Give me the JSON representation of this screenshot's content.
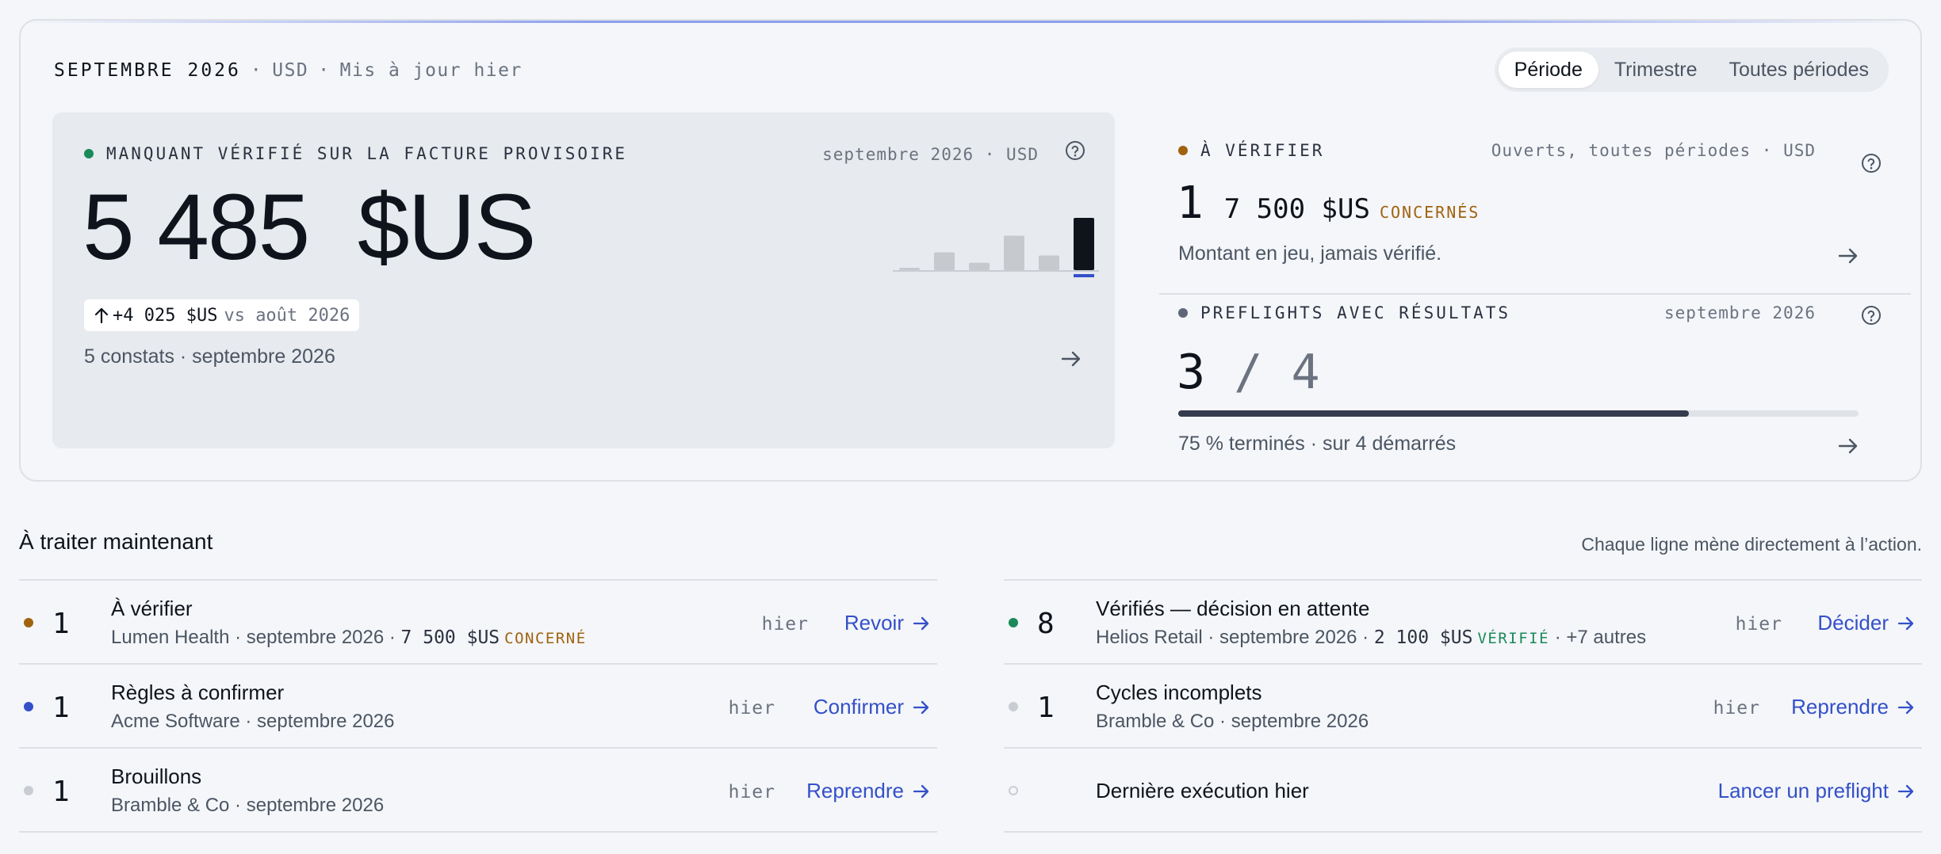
{
  "header": {
    "month": "SEPTEMBRE 2026",
    "currency": "USD",
    "updated": "Mis à jour hier",
    "separator": "·"
  },
  "period_tabs": [
    {
      "label": "Période",
      "active": true
    },
    {
      "label": "Trimestre",
      "active": false
    },
    {
      "label": "Toutes périodes",
      "active": false
    }
  ],
  "main_panel": {
    "kicker": "MANQUANT VÉRIFIÉ SUR LA FACTURE PROVISOIRE",
    "meta": "septembre 2026 · USD",
    "value": "5 485  $US",
    "delta_value": "+4 025  $US",
    "delta_vs": "vs août 2026",
    "footer": "5 constats · septembre 2026",
    "dot_color": "#1a8a5a",
    "sparkline_levels": [
      0.04,
      0.34,
      0.14,
      0.66,
      0.28,
      1.0
    ],
    "sparkline_highlight_index": 5
  },
  "verify_block": {
    "kicker": "À VÉRIFIER",
    "meta": "Ouverts, toutes périodes · USD",
    "count": "1",
    "amount": "7 500  $US",
    "tag": "CONCERNÉS",
    "text": "Montant en jeu, jamais vérifié.",
    "dot_color": "#a0620f"
  },
  "preflight_block": {
    "kicker": "PREFLIGHTS AVEC RÉSULTATS",
    "meta": "septembre 2026",
    "done": "3",
    "slash": " / ",
    "total": "4",
    "progress": 0.75,
    "text": "75 % terminés · sur 4 démarrés",
    "dot_color": "#5e6678"
  },
  "section": {
    "title": "À traiter maintenant",
    "note": "Chaque ligne mène directement à l’action."
  },
  "colors": {
    "accent_blue": "#3450c9",
    "amber": "#a0620f",
    "green": "#1a8a5a",
    "grey_dot": "#c9ccd2"
  },
  "tasks_left": [
    {
      "dot": "#a0620f",
      "count": "1",
      "title": "À vérifier",
      "sub_prefix": "Lumen Health · septembre 2026 · ",
      "sub_amount": "7 500  $US",
      "sub_tag": "CONCERNÉ",
      "sub_tag_color": "#a0620f",
      "sub_suffix": "",
      "when": "hier",
      "action": "Revoir"
    },
    {
      "dot": "#3450c9",
      "count": "1",
      "title": "Règles à confirmer",
      "sub_prefix": "Acme Software · septembre 2026",
      "sub_amount": "",
      "sub_tag": "",
      "sub_tag_color": "",
      "sub_suffix": "",
      "when": "hier",
      "action": "Confirmer"
    },
    {
      "dot": "#c9ccd2",
      "count": "1",
      "title": "Brouillons",
      "sub_prefix": "Bramble & Co · septembre 2026",
      "sub_amount": "",
      "sub_tag": "",
      "sub_tag_color": "",
      "sub_suffix": "",
      "when": "hier",
      "action": "Reprendre"
    }
  ],
  "tasks_right": [
    {
      "dot": "#1a8a5a",
      "count": "8",
      "title": "Vérifiés — décision en attente",
      "sub_prefix": "Helios Retail · septembre 2026 · ",
      "sub_amount": "2 100  $US",
      "sub_tag": "VÉRIFIÉ",
      "sub_tag_color": "#1a8a5a",
      "sub_suffix": " · +7 autres",
      "when": "hier",
      "action": "Décider"
    },
    {
      "dot": "#c9ccd2",
      "count": "1",
      "title": "Cycles incomplets",
      "sub_prefix": "Bramble & Co · septembre 2026",
      "sub_amount": "",
      "sub_tag": "",
      "sub_tag_color": "",
      "sub_suffix": "",
      "when": "hier",
      "action": "Reprendre"
    },
    {
      "dot": "hollow",
      "count": "",
      "title": "Dernière exécution hier",
      "sub_prefix": "",
      "sub_amount": "",
      "sub_tag": "",
      "sub_tag_color": "",
      "sub_suffix": "",
      "when": "",
      "action": "Lancer un preflight"
    }
  ],
  "icons": {
    "help": "help-circle-icon",
    "arrow_right": "arrow-right-icon",
    "arrow_up": "arrow-up-icon"
  }
}
